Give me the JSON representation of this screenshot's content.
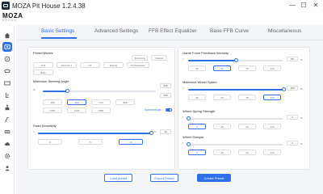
{
  "window": {
    "title": "MOZA Pit House 1.2.4.38",
    "minimize": "—",
    "maximize": "☐",
    "close": "✕"
  },
  "brand": {
    "name": "MOZA",
    "tagline": "RACING"
  },
  "sidebar": {
    "items": [
      {
        "icon": "home-icon",
        "active": false
      },
      {
        "icon": "wheelbase-icon",
        "active": true
      },
      {
        "icon": "wheel-icon",
        "active": false
      },
      {
        "icon": "steering-wheel-icon",
        "active": false
      },
      {
        "icon": "dashboard-icon",
        "active": false
      },
      {
        "icon": "pedals-icon",
        "active": false
      },
      {
        "icon": "shifter-icon",
        "active": false
      },
      {
        "icon": "handbrake-icon",
        "active": false
      },
      {
        "icon": "hub-icon",
        "active": false
      },
      {
        "icon": "cloud-icon",
        "active": false
      },
      {
        "icon": "settings-icon",
        "active": false
      },
      {
        "icon": "user-icon",
        "active": false
      }
    ]
  },
  "tabs": [
    {
      "label": "Basic Settings",
      "active": true
    },
    {
      "label": "Advanced Settings",
      "active": false
    },
    {
      "label": "FFB Effect Equalizer",
      "active": false
    },
    {
      "label": "Base FFB Curve",
      "active": false
    },
    {
      "label": "Miscellaneous",
      "active": false
    }
  ],
  "left_panel": {
    "preset_modes": {
      "label": "Preset Modes",
      "row1": [
        {
          "label": "Simracing",
          "active": false
        },
        {
          "label": "Casual",
          "active": false
        }
      ],
      "row2": [
        {
          "label": "Drift",
          "active": false
        },
        {
          "label": "Formula 1",
          "active": false
        },
        {
          "label": "GT",
          "active": false
        },
        {
          "label": "Racing",
          "active": false
        },
        {
          "label": "Performance",
          "active": false
        }
      ],
      "row3": [
        {
          "label": "Rally",
          "active": false
        }
      ]
    },
    "steering_angle": {
      "label": "Maximum Steering Angle",
      "min": "90",
      "value": "540",
      "value2": "540",
      "fraction": 0.22,
      "presets_row1": [
        {
          "label": "180",
          "active": false
        },
        {
          "label": "360",
          "active": true
        },
        {
          "label": "720",
          "active": false
        },
        {
          "label": "900",
          "active": false
        }
      ],
      "presets_row2": [
        {
          "label": "1080",
          "active": false
        },
        {
          "label": "1440",
          "active": false
        },
        {
          "label": "1800",
          "active": false
        }
      ],
      "sync_label": "Synchronous",
      "sync_on": true
    },
    "road_sensitivity": {
      "label": "Road Sensitivity",
      "min": "0",
      "max": "10",
      "value": "10",
      "fraction": 1.0,
      "presets": [
        {
          "label": "0",
          "active": false
        },
        {
          "label": "5",
          "active": false
        },
        {
          "label": "10",
          "active": true
        }
      ]
    }
  },
  "right_panel": {
    "game_ffb": {
      "label": "Game Force Feedback Intensity",
      "min": "0",
      "value": "50",
      "unit": "%",
      "fraction": 0.5,
      "presets": [
        {
          "label": "25",
          "active": false
        },
        {
          "label": "50",
          "active": true
        },
        {
          "label": "75",
          "active": false
        },
        {
          "label": "100",
          "active": false
        }
      ]
    },
    "wheel_speed": {
      "label": "Maximum Wheel Speed",
      "min": "0",
      "value": "100",
      "unit": "%",
      "fraction": 1.0,
      "presets": [
        {
          "label": "25",
          "active": false
        },
        {
          "label": "50",
          "active": false
        },
        {
          "label": "75",
          "active": false
        },
        {
          "label": "100",
          "active": true
        }
      ]
    },
    "spring_strength": {
      "label": "Wheel Spring Strength",
      "min": "0",
      "value": "0",
      "unit": "%",
      "fraction": 0.0,
      "presets": [
        {
          "label": "0",
          "active": true
        },
        {
          "label": "30",
          "active": false
        },
        {
          "label": "60",
          "active": false
        },
        {
          "label": "100",
          "active": false
        }
      ]
    },
    "wheel_damper": {
      "label": "Wheel Damper",
      "min": "0",
      "value": "0",
      "unit": "%",
      "fraction": 0.0,
      "presets": [
        {
          "label": "0",
          "active": true
        },
        {
          "label": "30",
          "active": false
        },
        {
          "label": "60",
          "active": false
        },
        {
          "label": "100",
          "active": false
        }
      ]
    }
  },
  "actions": {
    "load": "Load preset",
    "export": "Export Preset",
    "create": "Create Preset"
  },
  "colors": {
    "accent": "#2f6fe8",
    "background": "#f3f5f8",
    "panel": "#ffffff"
  }
}
